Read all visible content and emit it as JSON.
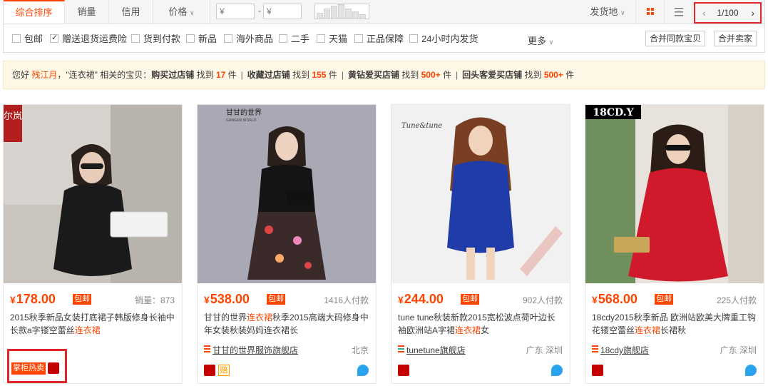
{
  "sortbar": {
    "tabs": [
      {
        "label": "综合排序",
        "active": true
      },
      {
        "label": "销量",
        "active": false
      },
      {
        "label": "信用",
        "active": false
      },
      {
        "label": "价格",
        "active": false
      }
    ],
    "price_min_placeholder": "¥",
    "price_max_placeholder": "¥",
    "price_dash": "-",
    "ship_from": "发货地",
    "pager": "1/100",
    "pager_prev": "‹",
    "pager_next": "›"
  },
  "filters": {
    "items": [
      {
        "label": "包邮",
        "checked": false
      },
      {
        "label": "赠送退货运费险",
        "checked": true
      },
      {
        "label": "货到付款",
        "checked": false
      },
      {
        "label": "新品",
        "checked": false
      },
      {
        "label": "海外商品",
        "checked": false
      },
      {
        "label": "二手",
        "checked": false
      },
      {
        "label": "天猫",
        "checked": false
      },
      {
        "label": "正品保障",
        "checked": false
      },
      {
        "label": "24小时内发货",
        "checked": false
      }
    ],
    "more": "更多",
    "merge_same": "合并同款宝贝",
    "merge_seller": "合并卖家"
  },
  "notice": {
    "greet": "您好",
    "user": "残江月",
    "query_text": "，\"连衣裙\" 相关的宝贝：",
    "seg1_label": "购买过店铺",
    "seg1_pre": " 找到 ",
    "seg1_num": "17",
    "seg1_unit": " 件",
    "seg2_label": "收藏过店铺",
    "seg2_pre": " 找到 ",
    "seg2_num": "155",
    "seg2_unit": " 件",
    "seg3_label": "黄钻爱买店铺",
    "seg3_pre": " 找到 ",
    "seg3_num": "500+",
    "seg3_unit": " 件",
    "seg4_label": "回头客爱买店铺",
    "seg4_pre": " 找到 ",
    "seg4_num": "500+",
    "seg4_unit": " 件",
    "sep": "|"
  },
  "products": [
    {
      "currency": "¥",
      "price": "178.00",
      "baoyou": "包邮",
      "sales": "销量：873",
      "title_a": "2015秋季新品女装打底裙子韩版修身长袖中长款a字镂空蕾丝",
      "title_hl": "连衣裙",
      "title_b": "",
      "brand_logo": "尔岚",
      "tag": "掌柜热卖"
    },
    {
      "currency": "¥",
      "price": "538.00",
      "baoyou": "包邮",
      "sales": "1416人付款",
      "title_a": "甘甘的世界",
      "title_hl": "连衣裙",
      "title_b": "秋季2015高端大码修身中年女装秋装妈妈连衣裙长",
      "brand_logo": "甘甘的世界",
      "brand_sub": "GANGAN WORLD",
      "shop": "甘甘的世界服饰旗舰店",
      "location": "北京",
      "pei": "赔"
    },
    {
      "currency": "¥",
      "price": "244.00",
      "baoyou": "包邮",
      "sales": "902人付款",
      "title_a": "tune tune秋装新款2015宽松波点荷叶边长袖欧洲站A字裙",
      "title_hl": "连衣裙",
      "title_b": "女",
      "brand_logo": "Tune&tune",
      "shop": "tunetune旗舰店",
      "location": "广东 深圳"
    },
    {
      "currency": "¥",
      "price": "568.00",
      "baoyou": "包邮",
      "sales": "225人付款",
      "title_a": "18cdy2015秋季新品 欧洲站欧美大牌重工钩花镂空蕾丝",
      "title_hl": "连衣裙",
      "title_b": "长裙秋",
      "brand_logo": "18CD.Y",
      "shop": "18cdy旗舰店",
      "location": "广东 深圳"
    }
  ],
  "colors": {
    "accent": "#ff4400",
    "highlight_box": "#e1262b",
    "tmall": "#c40000"
  }
}
